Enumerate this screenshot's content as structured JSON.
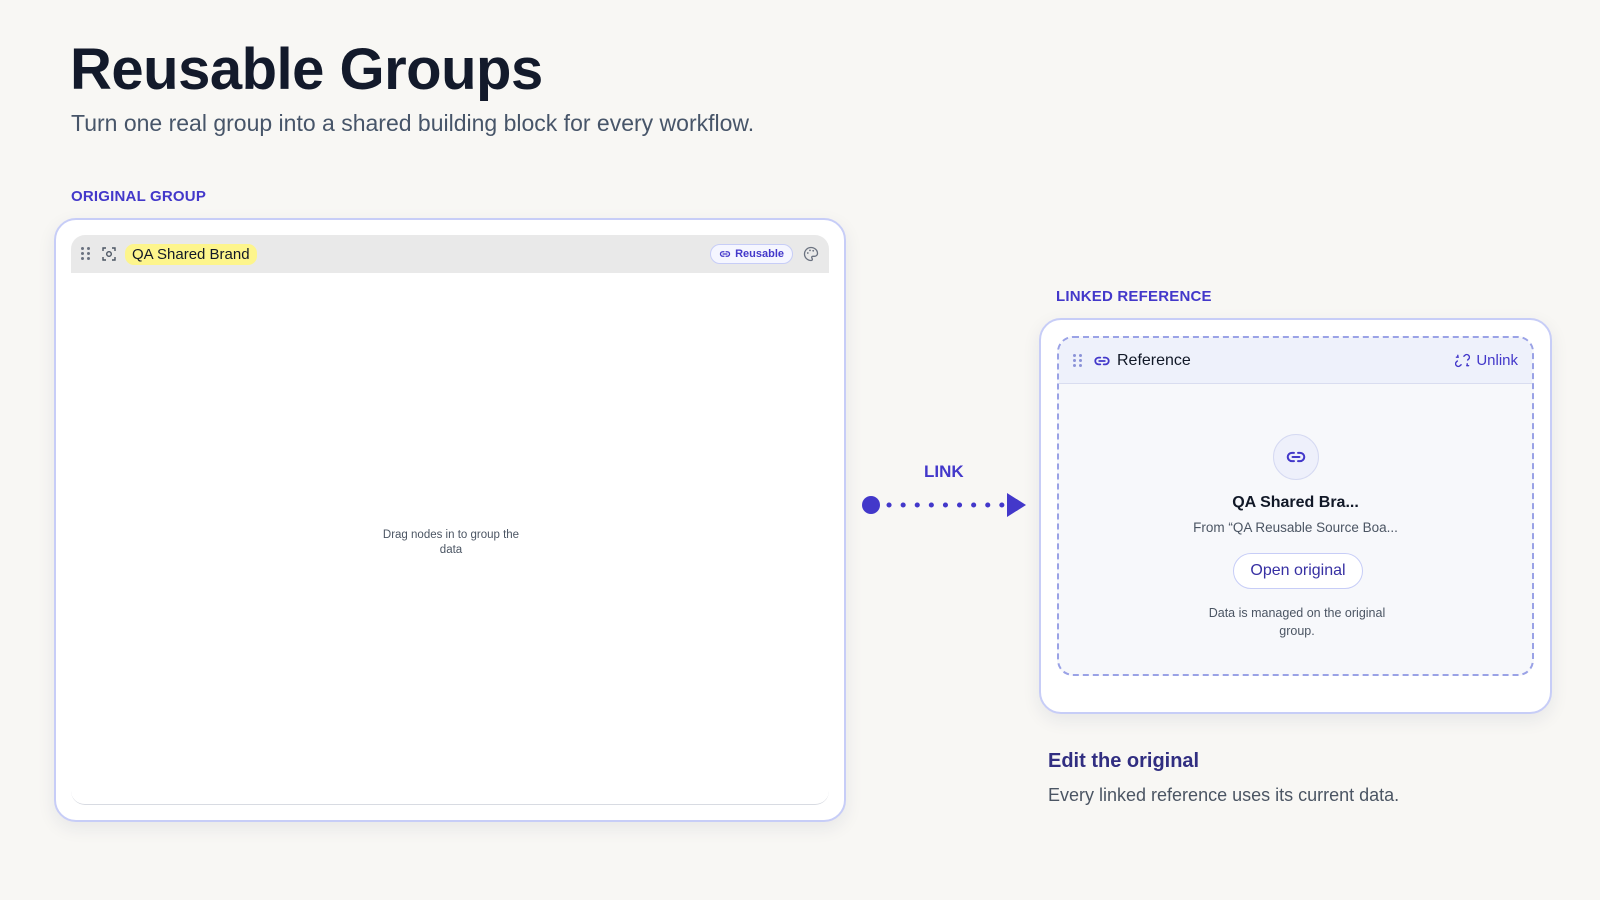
{
  "header": {
    "title": "Reusable Groups",
    "subtitle": "Turn one real group into a shared building block for every workflow."
  },
  "original": {
    "section_label": "ORIGINAL GROUP",
    "group_name": "QA Shared Brand",
    "badge_label": "Reusable",
    "empty_hint": "Drag nodes in to group the data",
    "icons": [
      "drag-handle-icon",
      "focus-frame-icon",
      "link-icon",
      "palette-icon"
    ]
  },
  "connector": {
    "label": "LINK"
  },
  "reference": {
    "section_label": "LINKED REFERENCE",
    "header_title": "Reference",
    "unlink_label": "Unlink",
    "name": "QA Shared Bra...",
    "source": "From “QA Reusable Source Boa...",
    "open_button": "Open original",
    "note": "Data is managed on the original group.",
    "icons": [
      "drag-handle-icon",
      "link-icon",
      "unlink-icon"
    ]
  },
  "footer_note": {
    "title": "Edit the original",
    "description": "Every linked reference uses its current data."
  },
  "colors": {
    "accent": "#4338ca",
    "highlight": "#fdf58c",
    "card_border": "#c7cdf7",
    "background": "#f8f7f4"
  }
}
